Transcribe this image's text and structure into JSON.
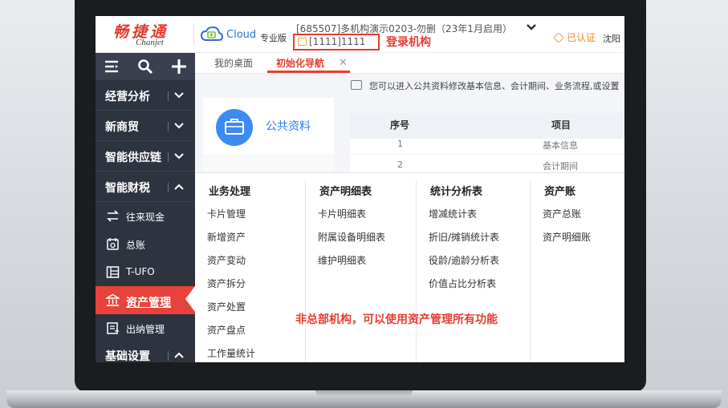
{
  "header": {
    "logo_cn": "畅捷通",
    "logo_en": "Chanjet",
    "cloud_text": "Cloud",
    "edition": "专业版",
    "org_name": "[685507]多机构演示0203-勿删（23年1月启用）",
    "org_code": "[1111]1111",
    "certified": "已认证",
    "region": "沈阳"
  },
  "annotations": {
    "login_org": "登录机构",
    "asset_note": "非总部机构，可以使用资产管理所有功能"
  },
  "sidebar": {
    "groups": [
      {
        "label": "经营分析"
      },
      {
        "label": "新商贸"
      },
      {
        "label": "智能供应链"
      },
      {
        "label": "智能财税"
      },
      {
        "label": "基础设置"
      }
    ],
    "subitems": [
      {
        "label": "往来现金",
        "icon": "transfer-icon"
      },
      {
        "label": "总账",
        "icon": "ledger-icon"
      },
      {
        "label": "T-UFO",
        "icon": "report-icon"
      },
      {
        "label": "资产管理",
        "icon": "bank-icon"
      },
      {
        "label": "出纳管理",
        "icon": "cashier-icon"
      }
    ]
  },
  "tabs": [
    {
      "label": "我的桌面"
    },
    {
      "label": "初始化导航"
    }
  ],
  "notice": "您可以进入公共资料修改基本信息、会计期间、业务流程,或设置",
  "card": {
    "title": "公共资料"
  },
  "table": {
    "headers": [
      "序号",
      "项目"
    ],
    "rows": [
      [
        "1",
        "基本信息"
      ],
      [
        "2",
        "会计期间"
      ]
    ]
  },
  "menu": {
    "columns": [
      {
        "title": "业务处理",
        "items": [
          "卡片管理",
          "新增资产",
          "资产变动",
          "资产拆分",
          "资产处置",
          "资产盘点",
          "工作量统计"
        ]
      },
      {
        "title": "资产明细表",
        "items": [
          "卡片明细表",
          "附属设备明细表",
          "维护明细表"
        ]
      },
      {
        "title": "统计分析表",
        "items": [
          "增减统计表",
          "折旧/摊销统计表",
          "役龄/逾龄分析表",
          "价值占比分析表"
        ]
      },
      {
        "title": "资产账",
        "items": [
          "资产总账",
          "资产明细账"
        ]
      }
    ]
  }
}
